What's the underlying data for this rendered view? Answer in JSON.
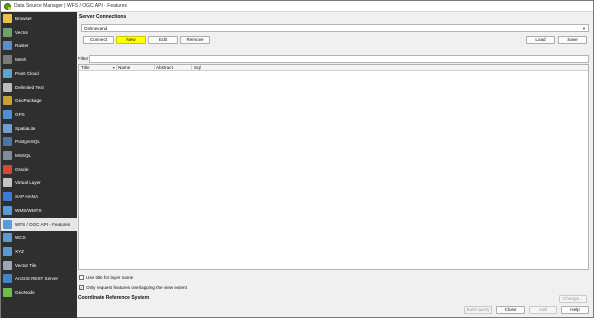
{
  "window": {
    "title": "Data Source Manager | WFS / OGC API - Features"
  },
  "sidebar": {
    "items": [
      {
        "label": "Browser",
        "icon": "browser-icon",
        "color": "#e8c24a"
      },
      {
        "label": "Vector",
        "icon": "vector-icon",
        "color": "#6da36b"
      },
      {
        "label": "Raster",
        "icon": "raster-icon",
        "color": "#5b8ccf"
      },
      {
        "label": "Mesh",
        "icon": "mesh-icon",
        "color": "#7a7a7a"
      },
      {
        "label": "Point Cloud",
        "icon": "point-cloud-icon",
        "color": "#58a6c9"
      },
      {
        "label": "Delimited Text",
        "icon": "delimited-text-icon",
        "color": "#bdbdbd"
      },
      {
        "label": "GeoPackage",
        "icon": "geopackage-icon",
        "color": "#c8a03a"
      },
      {
        "label": "GPS",
        "icon": "gps-icon",
        "color": "#4f8fd6"
      },
      {
        "label": "SpatiaLite",
        "icon": "spatialite-icon",
        "color": "#6e9fcf"
      },
      {
        "label": "PostgreSQL",
        "icon": "postgresql-icon",
        "color": "#4a76a8"
      },
      {
        "label": "MSSQL",
        "icon": "mssql-icon",
        "color": "#7f8c99"
      },
      {
        "label": "Oracle",
        "icon": "oracle-icon",
        "color": "#d04a3a"
      },
      {
        "label": "Virtual Layer",
        "icon": "virtual-layer-icon",
        "color": "#c4c4c4"
      },
      {
        "label": "SAP HANA",
        "icon": "sap-hana-icon",
        "color": "#3a7bd5"
      },
      {
        "label": "WMS/WMTS",
        "icon": "wms-wmts-icon",
        "color": "#5b9bd5"
      },
      {
        "label": "WFS / OGC API - Features",
        "icon": "wfs-icon",
        "color": "#5b9bd5",
        "active": true
      },
      {
        "label": "WCS",
        "icon": "wcs-icon",
        "color": "#5b9bd5"
      },
      {
        "label": "XYZ",
        "icon": "xyz-icon",
        "color": "#5b9bd5"
      },
      {
        "label": "Vector Tile",
        "icon": "vector-tile-icon",
        "color": "#9aa8b5"
      },
      {
        "label": "ArcGIS REST Server",
        "icon": "arcgis-rest-server-icon",
        "color": "#3f88c5"
      },
      {
        "label": "GeoNode",
        "icon": "geonode-icon",
        "color": "#6cbf4a"
      }
    ]
  },
  "server": {
    "title": "Server Connections",
    "selected": "Onlinevand",
    "buttons": {
      "connect": "Connect",
      "new": "New",
      "edit": "Edit",
      "remove": "Remove",
      "load": "Load",
      "save": "Save"
    }
  },
  "filter": {
    "label": "Filter"
  },
  "table": {
    "columns": [
      "Title",
      "Name",
      "Abstract",
      "Sql"
    ]
  },
  "options": {
    "use_title": "Use title for layer name",
    "only_request": "Only request features overlapping the view extent",
    "use_title_checked": false,
    "only_request_checked": true
  },
  "crs": {
    "title": "Coordinate Reference System",
    "change": "Change..."
  },
  "footer": {
    "build_query": "Build query",
    "close": "Close",
    "add": "Add",
    "help": "Help"
  },
  "colors": {
    "sidebar_bg": "#2f2f2f",
    "highlight": "#ffff00",
    "active_item_bg": "#e6e6e6"
  }
}
